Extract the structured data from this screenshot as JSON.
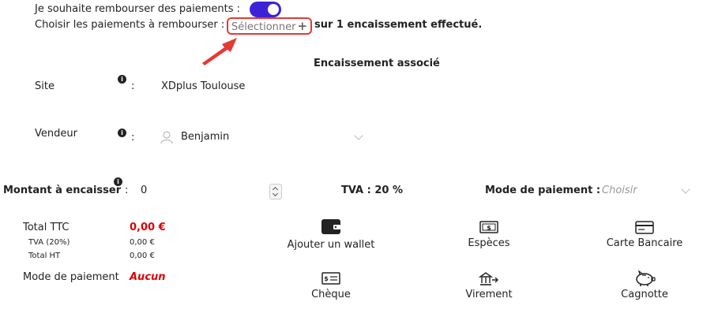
{
  "refund": {
    "toggle_label": "Je souhaite rembourser des paiements :",
    "toggle_on": true,
    "choose_label": "Choisir les paiements à rembourser :",
    "select_button": "Sélectionner",
    "select_suffix": "sur 1 encaissement effectué."
  },
  "section_title": "Encaissement associé",
  "site": {
    "label": "Site",
    "colon": ":",
    "value": "XDplus Toulouse"
  },
  "vendor": {
    "label": "Vendeur",
    "colon": ":",
    "value": "Benjamin"
  },
  "amount": {
    "label": "Montant à encaisser",
    "colon": ":",
    "value": "0"
  },
  "tva": {
    "label": "TVA : 20 %"
  },
  "payment_mode": {
    "label": "Mode de paiement :",
    "placeholder": "Choisir"
  },
  "totals": {
    "ttc_label": "Total TTC",
    "ttc_value": "0,00 €",
    "tva_label": "TVA (20%)",
    "tva_value": "0,00 €",
    "ht_label": "Total HT",
    "ht_value": "0,00 €",
    "mode_label": "Mode de paiement",
    "mode_value": "Aucun"
  },
  "payment_options": [
    {
      "label": "Ajouter un wallet",
      "icon": "wallet-icon"
    },
    {
      "label": "Espèces",
      "icon": "cash-icon"
    },
    {
      "label": "Carte Bancaire",
      "icon": "credit-card-icon"
    },
    {
      "label": "Chèque",
      "icon": "cheque-icon"
    },
    {
      "label": "Virement",
      "icon": "bank-transfer-icon"
    },
    {
      "label": "Cagnotte",
      "icon": "piggy-bank-icon"
    }
  ],
  "colors": {
    "accent": "#3d21d6",
    "danger": "#e00000",
    "arrow": "#e53935"
  }
}
